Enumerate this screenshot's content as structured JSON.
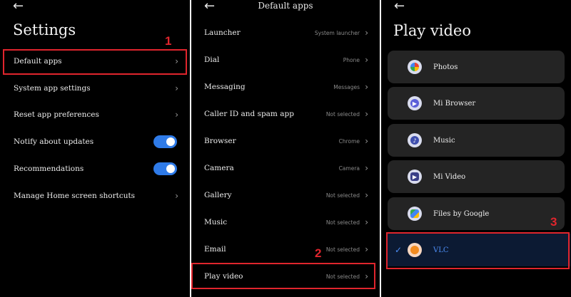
{
  "settings": {
    "title": "Settings",
    "items": [
      {
        "label": "Default apps"
      },
      {
        "label": "System app settings"
      },
      {
        "label": "Reset app preferences"
      },
      {
        "label": "Notify about updates"
      },
      {
        "label": "Recommendations"
      },
      {
        "label": "Manage Home screen shortcuts"
      }
    ]
  },
  "default_apps": {
    "title": "Default apps",
    "items": [
      {
        "label": "Launcher",
        "value": "System launcher"
      },
      {
        "label": "Dial",
        "value": "Phone"
      },
      {
        "label": "Messaging",
        "value": "Messages"
      },
      {
        "label": "Caller ID and spam app",
        "value": "Not selected"
      },
      {
        "label": "Browser",
        "value": "Chrome"
      },
      {
        "label": "Camera",
        "value": "Camera"
      },
      {
        "label": "Gallery",
        "value": "Not selected"
      },
      {
        "label": "Music",
        "value": "Not selected"
      },
      {
        "label": "Email",
        "value": "Not selected"
      },
      {
        "label": "Play video",
        "value": "Not selected"
      }
    ]
  },
  "play_video": {
    "title": "Play video",
    "options": [
      {
        "label": "Photos",
        "icon": "photos-icon"
      },
      {
        "label": "Mi Browser",
        "icon": "mi-browser-icon"
      },
      {
        "label": "Music",
        "icon": "music-icon"
      },
      {
        "label": "Mi Video",
        "icon": "mi-video-icon"
      },
      {
        "label": "Files by Google",
        "icon": "files-icon"
      },
      {
        "label": "VLC",
        "icon": "vlc-icon",
        "selected": true
      }
    ]
  },
  "annotations": {
    "n1": "1",
    "n2": "2",
    "n3": "3"
  },
  "glyphs": {
    "back": "←",
    "chevron": "›",
    "check": "✓"
  },
  "colors": {
    "accent": "#2f7be8",
    "annotation": "#e0252d",
    "selected_bg": "#0c1a33"
  }
}
